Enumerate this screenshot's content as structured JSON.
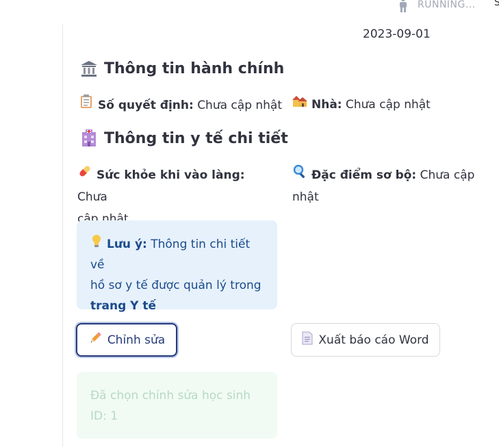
{
  "status": {
    "text": "RUNNING...",
    "extra": "S"
  },
  "date": "2023-09-01",
  "admin": {
    "heading": "Thông tin hành chính",
    "icon": "bank-icon",
    "decision_label": "Số quyết định:",
    "decision_value": "Chưa cập nhật",
    "house_label": "Nhà:",
    "house_value": "Chưa cập nhật"
  },
  "medical": {
    "heading": "Thông tin y tế chi tiết",
    "icon": "hospital-icon",
    "health_label": "Sức khỏe khi vào làng:",
    "health_value_1": "Chưa",
    "health_value_2": "cập nhật",
    "traits_label": "Đặc điểm sơ bộ:",
    "traits_value": "Chưa cập nhật"
  },
  "note": {
    "label": "Lưu ý:",
    "text_1": "Thông tin chi tiết về",
    "text_2": "hồ sơ y tế được quản lý trong",
    "link": "trang Y tế"
  },
  "buttons": {
    "edit": "Chỉnh sửa",
    "export": "Xuất báo cáo Word"
  },
  "success": {
    "line_1": "Đã chọn chỉnh sửa học sinh",
    "line_2": "ID: 1"
  },
  "colors": {
    "info_bg": "#e6f1fc",
    "info_text": "#1b4a8c",
    "success_bg": "#f1fbf4",
    "primary": "#233a7a"
  }
}
